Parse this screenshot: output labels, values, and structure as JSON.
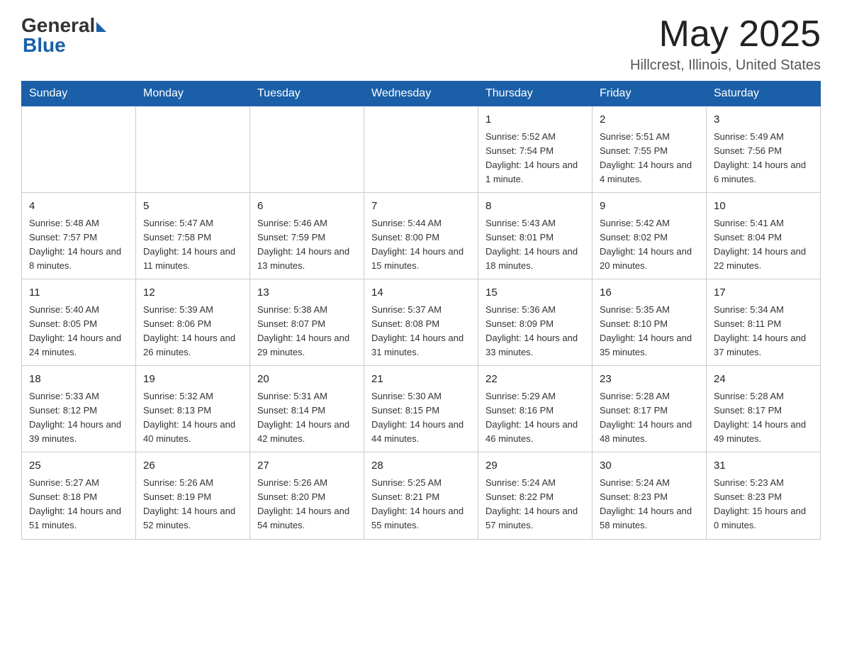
{
  "header": {
    "logo_general": "General",
    "logo_blue": "Blue",
    "title": "May 2025",
    "location": "Hillcrest, Illinois, United States"
  },
  "weekdays": [
    "Sunday",
    "Monday",
    "Tuesday",
    "Wednesday",
    "Thursday",
    "Friday",
    "Saturday"
  ],
  "weeks": [
    [
      {
        "day": "",
        "info": ""
      },
      {
        "day": "",
        "info": ""
      },
      {
        "day": "",
        "info": ""
      },
      {
        "day": "",
        "info": ""
      },
      {
        "day": "1",
        "info": "Sunrise: 5:52 AM\nSunset: 7:54 PM\nDaylight: 14 hours and 1 minute."
      },
      {
        "day": "2",
        "info": "Sunrise: 5:51 AM\nSunset: 7:55 PM\nDaylight: 14 hours and 4 minutes."
      },
      {
        "day": "3",
        "info": "Sunrise: 5:49 AM\nSunset: 7:56 PM\nDaylight: 14 hours and 6 minutes."
      }
    ],
    [
      {
        "day": "4",
        "info": "Sunrise: 5:48 AM\nSunset: 7:57 PM\nDaylight: 14 hours and 8 minutes."
      },
      {
        "day": "5",
        "info": "Sunrise: 5:47 AM\nSunset: 7:58 PM\nDaylight: 14 hours and 11 minutes."
      },
      {
        "day": "6",
        "info": "Sunrise: 5:46 AM\nSunset: 7:59 PM\nDaylight: 14 hours and 13 minutes."
      },
      {
        "day": "7",
        "info": "Sunrise: 5:44 AM\nSunset: 8:00 PM\nDaylight: 14 hours and 15 minutes."
      },
      {
        "day": "8",
        "info": "Sunrise: 5:43 AM\nSunset: 8:01 PM\nDaylight: 14 hours and 18 minutes."
      },
      {
        "day": "9",
        "info": "Sunrise: 5:42 AM\nSunset: 8:02 PM\nDaylight: 14 hours and 20 minutes."
      },
      {
        "day": "10",
        "info": "Sunrise: 5:41 AM\nSunset: 8:04 PM\nDaylight: 14 hours and 22 minutes."
      }
    ],
    [
      {
        "day": "11",
        "info": "Sunrise: 5:40 AM\nSunset: 8:05 PM\nDaylight: 14 hours and 24 minutes."
      },
      {
        "day": "12",
        "info": "Sunrise: 5:39 AM\nSunset: 8:06 PM\nDaylight: 14 hours and 26 minutes."
      },
      {
        "day": "13",
        "info": "Sunrise: 5:38 AM\nSunset: 8:07 PM\nDaylight: 14 hours and 29 minutes."
      },
      {
        "day": "14",
        "info": "Sunrise: 5:37 AM\nSunset: 8:08 PM\nDaylight: 14 hours and 31 minutes."
      },
      {
        "day": "15",
        "info": "Sunrise: 5:36 AM\nSunset: 8:09 PM\nDaylight: 14 hours and 33 minutes."
      },
      {
        "day": "16",
        "info": "Sunrise: 5:35 AM\nSunset: 8:10 PM\nDaylight: 14 hours and 35 minutes."
      },
      {
        "day": "17",
        "info": "Sunrise: 5:34 AM\nSunset: 8:11 PM\nDaylight: 14 hours and 37 minutes."
      }
    ],
    [
      {
        "day": "18",
        "info": "Sunrise: 5:33 AM\nSunset: 8:12 PM\nDaylight: 14 hours and 39 minutes."
      },
      {
        "day": "19",
        "info": "Sunrise: 5:32 AM\nSunset: 8:13 PM\nDaylight: 14 hours and 40 minutes."
      },
      {
        "day": "20",
        "info": "Sunrise: 5:31 AM\nSunset: 8:14 PM\nDaylight: 14 hours and 42 minutes."
      },
      {
        "day": "21",
        "info": "Sunrise: 5:30 AM\nSunset: 8:15 PM\nDaylight: 14 hours and 44 minutes."
      },
      {
        "day": "22",
        "info": "Sunrise: 5:29 AM\nSunset: 8:16 PM\nDaylight: 14 hours and 46 minutes."
      },
      {
        "day": "23",
        "info": "Sunrise: 5:28 AM\nSunset: 8:17 PM\nDaylight: 14 hours and 48 minutes."
      },
      {
        "day": "24",
        "info": "Sunrise: 5:28 AM\nSunset: 8:17 PM\nDaylight: 14 hours and 49 minutes."
      }
    ],
    [
      {
        "day": "25",
        "info": "Sunrise: 5:27 AM\nSunset: 8:18 PM\nDaylight: 14 hours and 51 minutes."
      },
      {
        "day": "26",
        "info": "Sunrise: 5:26 AM\nSunset: 8:19 PM\nDaylight: 14 hours and 52 minutes."
      },
      {
        "day": "27",
        "info": "Sunrise: 5:26 AM\nSunset: 8:20 PM\nDaylight: 14 hours and 54 minutes."
      },
      {
        "day": "28",
        "info": "Sunrise: 5:25 AM\nSunset: 8:21 PM\nDaylight: 14 hours and 55 minutes."
      },
      {
        "day": "29",
        "info": "Sunrise: 5:24 AM\nSunset: 8:22 PM\nDaylight: 14 hours and 57 minutes."
      },
      {
        "day": "30",
        "info": "Sunrise: 5:24 AM\nSunset: 8:23 PM\nDaylight: 14 hours and 58 minutes."
      },
      {
        "day": "31",
        "info": "Sunrise: 5:23 AM\nSunset: 8:23 PM\nDaylight: 15 hours and 0 minutes."
      }
    ]
  ]
}
